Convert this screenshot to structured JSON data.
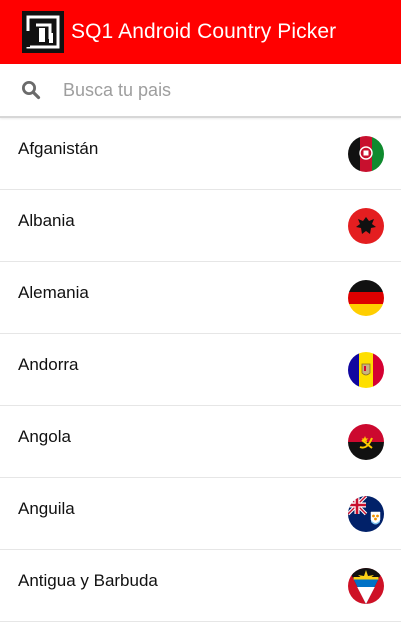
{
  "app_bar": {
    "title": "SQ1 Android Country Picker",
    "logo_icon": "sq1-logo-icon",
    "color": "#ff0000"
  },
  "search": {
    "icon": "search-icon",
    "placeholder": "Busca tu pais",
    "value": ""
  },
  "countries": [
    {
      "name": "Afganistán",
      "flag": "afghanistan-flag-icon"
    },
    {
      "name": "Albania",
      "flag": "albania-flag-icon"
    },
    {
      "name": "Alemania",
      "flag": "germany-flag-icon"
    },
    {
      "name": "Andorra",
      "flag": "andorra-flag-icon"
    },
    {
      "name": "Angola",
      "flag": "angola-flag-icon"
    },
    {
      "name": "Anguila",
      "flag": "anguilla-flag-icon"
    },
    {
      "name": "Antigua y Barbuda",
      "flag": "antigua-and-barbuda-flag-icon"
    }
  ]
}
